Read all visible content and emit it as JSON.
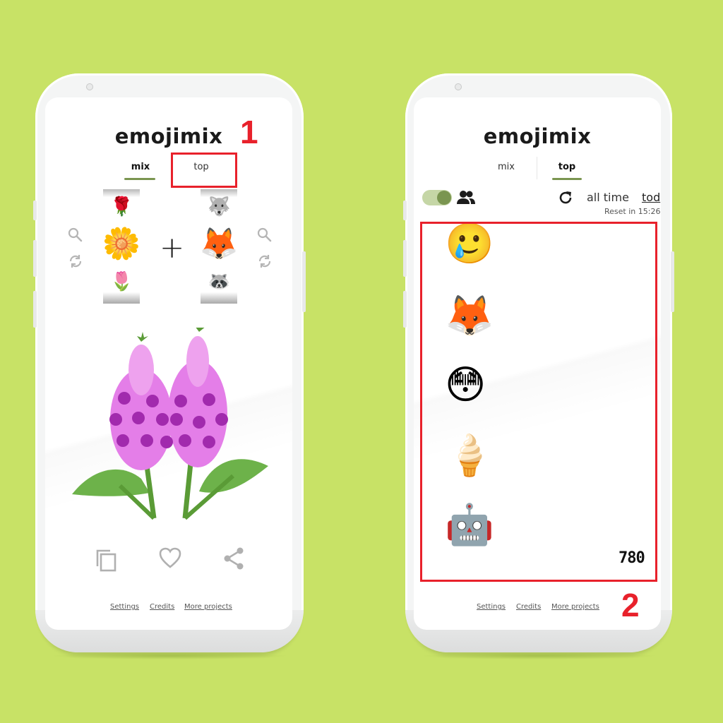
{
  "annotations": {
    "label_1": "1",
    "label_2": "2",
    "color": "#e8212b"
  },
  "theme": {
    "background": "#c8e266",
    "accent": "#7a9550"
  },
  "left_phone": {
    "brand": "emojimix",
    "tabs": [
      {
        "label": "mix",
        "active": true
      },
      {
        "label": "top",
        "active": false
      }
    ],
    "left_reel": {
      "above": "🌹",
      "selected": "🌼",
      "below": "🌷"
    },
    "right_reel": {
      "above": "🐺",
      "selected": "🦊",
      "below": "🦝"
    },
    "left_controls": {
      "search_icon": "search-icon",
      "shuffle_icon": "shuffle-icon"
    },
    "right_controls": {
      "search_icon": "search-icon",
      "shuffle_icon": "shuffle-icon"
    },
    "operator": "+",
    "result": "foxglove-mix",
    "actions": [
      {
        "name": "copy-icon"
      },
      {
        "name": "heart-icon"
      },
      {
        "name": "share-icon"
      }
    ],
    "footer_links": [
      "Settings",
      "Credits",
      "More projects"
    ]
  },
  "right_phone": {
    "brand": "emojimix",
    "tabs": [
      {
        "label": "mix",
        "active": false
      },
      {
        "label": "top",
        "active": true
      }
    ],
    "toolbar": {
      "toggle_on": true,
      "users_icon": "users-icon",
      "refresh_icon": "refresh-icon",
      "range_options": [
        "all time",
        "tod"
      ],
      "reset_text": "Reset in 15:26"
    },
    "top_list": [
      {
        "emoji": "🥲"
      },
      {
        "emoji": "🦊"
      },
      {
        "emoji": "😳"
      },
      {
        "emoji": "🍦"
      },
      {
        "emoji": "🤖"
      }
    ],
    "counter": "780",
    "footer_links": [
      "Settings",
      "Credits",
      "More projects"
    ]
  }
}
